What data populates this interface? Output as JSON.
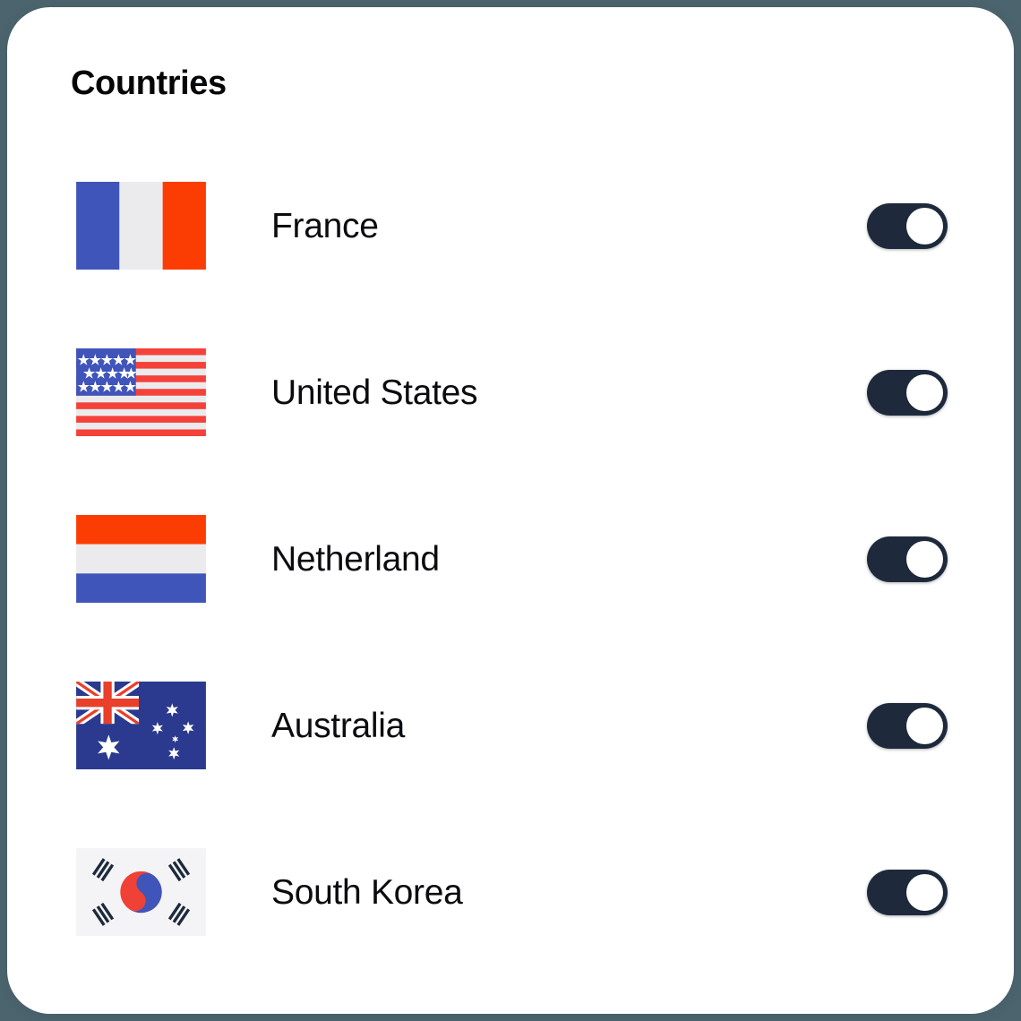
{
  "card": {
    "title": "Countries",
    "background_color": "#ffffff",
    "corner_radius_px": 48
  },
  "page": {
    "background_color": "#4c646e"
  },
  "colors": {
    "title_text": "#050608",
    "row_text": "#0b0c0f",
    "toggle_on_track": "#1e2a3c",
    "toggle_knob": "#ffffff",
    "flag_red": "#fc3d03",
    "flag_blue": "#4055ba",
    "flag_white": "#ebebed",
    "us_red": "#f4413a",
    "us_blue": "#4055ba",
    "au_navy": "#2b3a8f",
    "kr_red": "#ef4136",
    "kr_blue": "#4055ba",
    "kr_black": "#1e2a3c"
  },
  "list": {
    "rows": [
      {
        "name": "France",
        "flag": "flag-france-icon",
        "toggle": {
          "state": "on",
          "label": "France toggle"
        }
      },
      {
        "name": "United States",
        "flag": "flag-united-states-icon",
        "toggle": {
          "state": "on",
          "label": "United States toggle"
        }
      },
      {
        "name": "Netherland",
        "flag": "flag-netherlands-icon",
        "toggle": {
          "state": "on",
          "label": "Netherland toggle"
        }
      },
      {
        "name": "Australia",
        "flag": "flag-australia-icon",
        "toggle": {
          "state": "on",
          "label": "Australia toggle"
        }
      },
      {
        "name": "South Korea",
        "flag": "flag-south-korea-icon",
        "toggle": {
          "state": "on",
          "label": "South Korea toggle"
        }
      }
    ]
  }
}
